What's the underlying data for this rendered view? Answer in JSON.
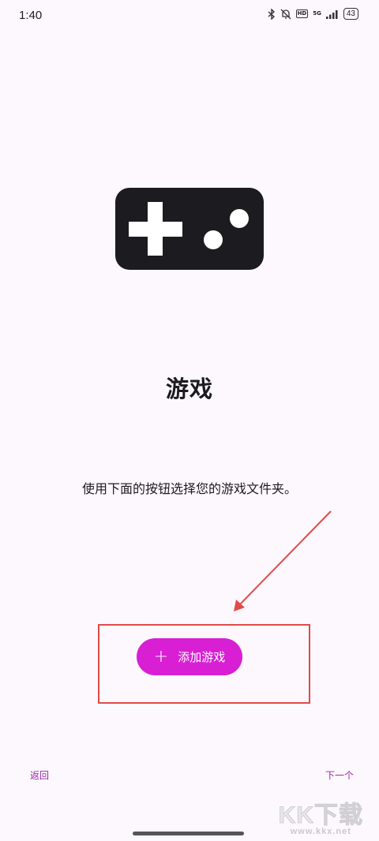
{
  "status_bar": {
    "time": "1:40",
    "hd_label": "HD",
    "network_label": "5G",
    "battery": "43"
  },
  "icons": {
    "hero": "gamepad-icon",
    "add": "plus-icon"
  },
  "main": {
    "title": "游戏",
    "description": "使用下面的按钮选择您的游戏文件夹。",
    "add_button_label": "添加游戏"
  },
  "footer": {
    "back_label": "返回",
    "next_label": "下一个"
  },
  "watermark": {
    "main": "KK下载",
    "sub": "www.kkx.net"
  },
  "colors": {
    "background": "#fdf8fd",
    "accent": "#d81fd4",
    "link": "#9c27b0",
    "annotation": "#e14a4a"
  }
}
